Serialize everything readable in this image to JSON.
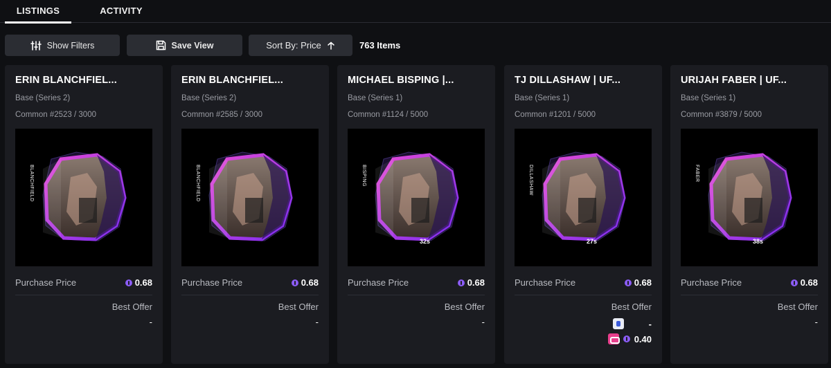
{
  "tabs": [
    {
      "label": "LISTINGS",
      "active": true
    },
    {
      "label": "ACTIVITY",
      "active": false
    }
  ],
  "toolbar": {
    "filters_label": "Show Filters",
    "save_label": "Save View",
    "sort_label": "Sort By: Price",
    "items_count": "763 Items"
  },
  "colors": {
    "background": "#0f1013",
    "card": "#1b1c21",
    "button": "#2b2d33",
    "accent_purple": "#8b5cf6",
    "cage_magenta": "#c23ad6"
  },
  "cards": [
    {
      "title": "ERIN BLANCHFIEL...",
      "set": "Base (Series 2)",
      "serial": "Common #2523 / 3000",
      "fighter_name": "BLANCHFIELD",
      "price_label": "Purchase Price",
      "price": "0.68",
      "offer_label": "Best Offer",
      "offer_value": "-"
    },
    {
      "title": "ERIN BLANCHFIEL...",
      "set": "Base (Series 2)",
      "serial": "Common #2585 / 3000",
      "fighter_name": "BLANCHFIELD",
      "price_label": "Purchase Price",
      "price": "0.68",
      "offer_label": "Best Offer",
      "offer_value": "-"
    },
    {
      "title": "MICHAEL BISPING |...",
      "set": "Base (Series 1)",
      "serial": "Common #1124 / 5000",
      "fighter_name": "BISPING",
      "duration": "32s",
      "price_label": "Purchase Price",
      "price": "0.68",
      "offer_label": "Best Offer",
      "offer_value": "-"
    },
    {
      "title": "TJ DILLASHAW | UF...",
      "set": "Base (Series 1)",
      "serial": "Common #1201 / 5000",
      "fighter_name": "DILLASHAW",
      "duration": "27s",
      "price_label": "Purchase Price",
      "price": "0.68",
      "offer_label": "Best Offer",
      "offer_value": "-",
      "offer_value_2": "0.40"
    },
    {
      "title": "URIJAH FABER | UF...",
      "set": "Base (Series 1)",
      "serial": "Common #3879 / 5000",
      "fighter_name": "FABER",
      "duration": "38s",
      "price_label": "Purchase Price",
      "price": "0.68",
      "offer_label": "Best Offer",
      "offer_value": "-"
    }
  ]
}
